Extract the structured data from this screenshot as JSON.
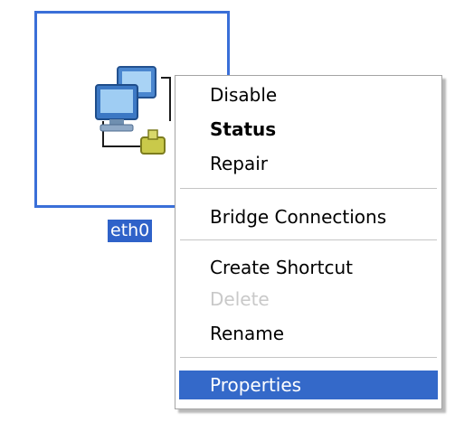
{
  "desktop": {
    "icon": {
      "name": "network-connection-icon",
      "label": "eth0",
      "selected": true
    }
  },
  "context_menu": {
    "items": [
      {
        "label": "Disable",
        "bold": false,
        "disabled": false,
        "highlighted": false
      },
      {
        "label": "Status",
        "bold": true,
        "disabled": false,
        "highlighted": false
      },
      {
        "label": "Repair",
        "bold": false,
        "disabled": false,
        "highlighted": false
      },
      {
        "label": "Bridge Connections",
        "bold": false,
        "disabled": false,
        "highlighted": false
      },
      {
        "label": "Create Shortcut",
        "bold": false,
        "disabled": false,
        "highlighted": false
      },
      {
        "label": "Delete",
        "bold": false,
        "disabled": true,
        "highlighted": false
      },
      {
        "label": "Rename",
        "bold": false,
        "disabled": false,
        "highlighted": false
      },
      {
        "label": "Properties",
        "bold": false,
        "disabled": false,
        "highlighted": true
      }
    ]
  },
  "colors": {
    "selection_blue": "#2f62c9",
    "highlight_blue": "#3469c9",
    "disabled_text": "#c9c9c9"
  }
}
